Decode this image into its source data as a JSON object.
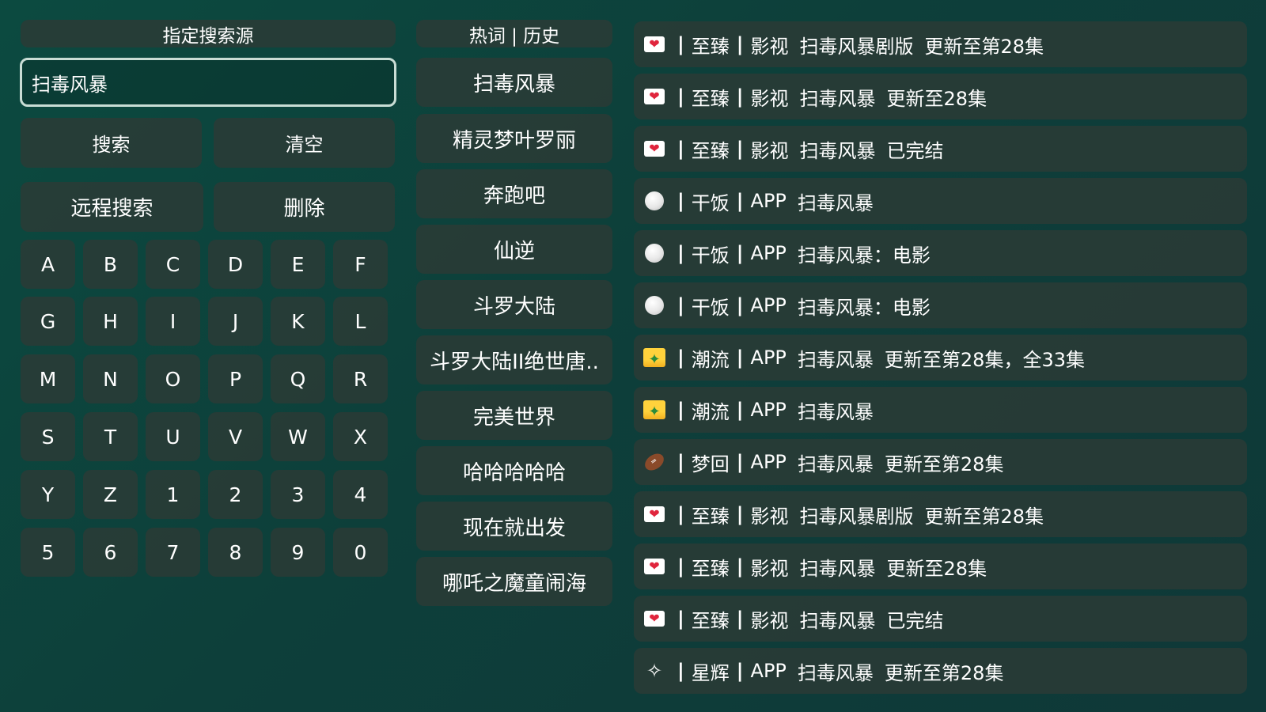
{
  "search_panel": {
    "source_header": "指定搜索源",
    "query": "扫毒风暴",
    "buttons": {
      "search": "搜索",
      "clear": "清空",
      "remote_search": "远程搜索",
      "delete": "删除"
    },
    "keys": [
      "A",
      "B",
      "C",
      "D",
      "E",
      "F",
      "G",
      "H",
      "I",
      "J",
      "K",
      "L",
      "M",
      "N",
      "O",
      "P",
      "Q",
      "R",
      "S",
      "T",
      "U",
      "V",
      "W",
      "X",
      "Y",
      "Z",
      "1",
      "2",
      "3",
      "4",
      "5",
      "6",
      "7",
      "8",
      "9",
      "0"
    ]
  },
  "hot_panel": {
    "header": "热词 | 历史",
    "items": [
      "扫毒风暴",
      "精灵梦叶罗丽",
      "奔跑吧",
      "仙逆",
      "斗罗大陆",
      "斗罗大陆II绝世唐..",
      "完美世界",
      "哈哈哈哈哈",
      "现在就出发",
      "哪吒之魔童闹海"
    ]
  },
  "results": [
    {
      "icon": "love-letter-icon",
      "separator": "|",
      "source": "至臻",
      "type": "影视",
      "title": "扫毒风暴剧版",
      "note": "更新至第28集"
    },
    {
      "icon": "love-letter-icon",
      "separator": "|",
      "source": "至臻",
      "type": "影视",
      "title": "扫毒风暴",
      "note": "更新至28集"
    },
    {
      "icon": "love-letter-icon",
      "separator": "|",
      "source": "至臻",
      "type": "影视",
      "title": "扫毒风暴",
      "note": "已完结"
    },
    {
      "icon": "rice-ball-icon",
      "separator": "|",
      "source": "干饭",
      "type": "APP",
      "title": "扫毒风暴",
      "note": ""
    },
    {
      "icon": "rice-ball-icon",
      "separator": "|",
      "source": "干饭",
      "type": "APP",
      "title": "扫毒风暴：电影",
      "note": ""
    },
    {
      "icon": "rice-ball-icon",
      "separator": "|",
      "source": "干饭",
      "type": "APP",
      "title": "扫毒风暴：电影",
      "note": ""
    },
    {
      "icon": "desert-icon",
      "separator": "|",
      "source": "潮流",
      "type": "APP",
      "title": "扫毒风暴",
      "note": "更新至第28集，全33集"
    },
    {
      "icon": "desert-icon",
      "separator": "|",
      "source": "潮流",
      "type": "APP",
      "title": "扫毒风暴",
      "note": ""
    },
    {
      "icon": "football-icon",
      "separator": "|",
      "source": "梦回",
      "type": "APP",
      "title": "扫毒风暴",
      "note": "更新至第28集"
    },
    {
      "icon": "love-letter-icon",
      "separator": "|",
      "source": "至臻",
      "type": "影视",
      "title": "扫毒风暴剧版",
      "note": "更新至第28集"
    },
    {
      "icon": "love-letter-icon",
      "separator": "|",
      "source": "至臻",
      "type": "影视",
      "title": "扫毒风暴",
      "note": "更新至28集"
    },
    {
      "icon": "love-letter-icon",
      "separator": "|",
      "source": "至臻",
      "type": "影视",
      "title": "扫毒风暴",
      "note": "已完结"
    },
    {
      "icon": "swan-icon",
      "separator": "|",
      "source": "星辉",
      "type": "APP",
      "title": "扫毒风暴",
      "note": "更新至第28集"
    }
  ],
  "colors": {
    "background": "#0d4239",
    "button_fill": "#2c3a36",
    "input_border": "#c9ddd5",
    "text": "#ffffff"
  }
}
